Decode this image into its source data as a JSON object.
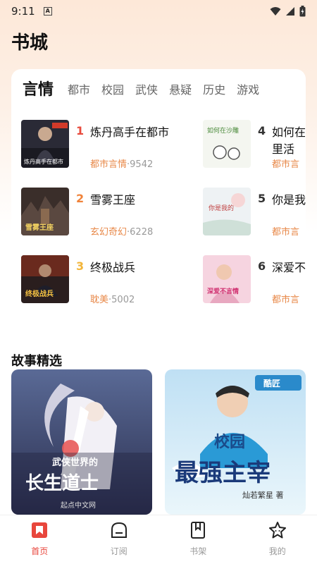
{
  "status": {
    "time": "9:11",
    "app_badge": "A"
  },
  "page_title": "书城",
  "tabs": [
    {
      "label": "言情",
      "active": true
    },
    {
      "label": "都市",
      "active": false
    },
    {
      "label": "校园",
      "active": false
    },
    {
      "label": "武侠",
      "active": false
    },
    {
      "label": "悬疑",
      "active": false
    },
    {
      "label": "历史",
      "active": false
    },
    {
      "label": "游戏",
      "active": false
    }
  ],
  "books": [
    {
      "rank": "1",
      "title": "炼丹高手在都市",
      "category": "都市言情",
      "count": "9542",
      "rank_color": "#e84a3c",
      "cover_text": "炼丹高手在都市"
    },
    {
      "rank": "2",
      "title": "雪雾王座",
      "category": "玄幻奇幻",
      "count": "6228",
      "rank_color": "#f0833a",
      "cover_text": "雪雾王座"
    },
    {
      "rank": "3",
      "title": "终极战兵",
      "category": "耽美",
      "count": "5002",
      "rank_color": "#f2b53a",
      "cover_text": "终极战兵"
    },
    {
      "rank": "4",
      "title": "如何在",
      "title_line2": "里活",
      "category": "都市言",
      "count": "",
      "rank_color": "#333333",
      "cover_text": "如何在沙雕"
    },
    {
      "rank": "5",
      "title": "你是我",
      "category": "都市言",
      "count": "",
      "rank_color": "#333333",
      "cover_text": "你是我的"
    },
    {
      "rank": "6",
      "title": "深爱不",
      "category": "都市言",
      "count": "",
      "rank_color": "#333333",
      "cover_text": "深爱不言情"
    }
  ],
  "meta_separator": "·",
  "section_title": "故事精选",
  "stories": [
    {
      "cover_title": "长生道士",
      "cover_sub": "武侠世界的",
      "publisher": "起点中文网"
    },
    {
      "cover_title": "最强主宰",
      "cover_sub": "校园",
      "author": "灿若繁星 著",
      "badge": "酷匠"
    }
  ],
  "nav": [
    {
      "label": "首页",
      "icon": "home-bookmark-icon",
      "active": true
    },
    {
      "label": "订阅",
      "icon": "subscribe-icon",
      "active": false
    },
    {
      "label": "书架",
      "icon": "bookshelf-icon",
      "active": false
    },
    {
      "label": "我的",
      "icon": "profile-star-icon",
      "active": false
    }
  ],
  "colors": {
    "accent": "#e8463c",
    "category": "#e8894a"
  }
}
